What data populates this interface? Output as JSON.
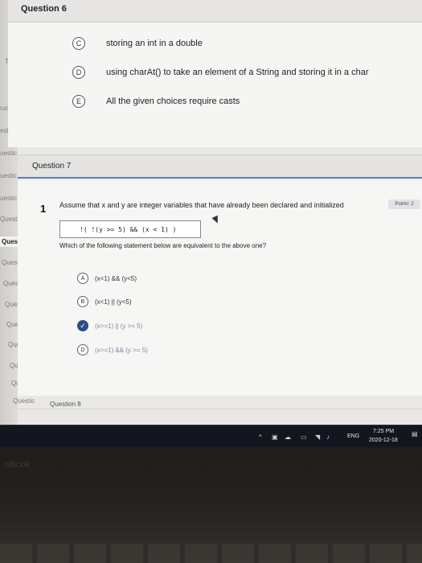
{
  "left_rail": {
    "items": [
      "T",
      "ruc",
      "estic",
      "uestic",
      "uestic",
      "uestic",
      "Questic",
      "Questic",
      "Questic",
      "Questic",
      "Questic",
      "Questic",
      "Questic",
      "Questic",
      "Questic",
      "Questic",
      "Questic"
    ],
    "active_label": "Questic"
  },
  "question6": {
    "title": "Question 6",
    "options": [
      {
        "letter": "C",
        "text": "storing an int in a double"
      },
      {
        "letter": "D",
        "text": "using charAt() to take an element of a String and storing it in a char"
      },
      {
        "letter": "E",
        "text": "All the given choices require casts"
      }
    ]
  },
  "question7": {
    "title": "Question 7",
    "number": "1",
    "prompt": "Assume that x and y are integer variables that have already been declared and initialized",
    "points": "Points: 2",
    "code": "!( !(y >= 5) && (x < 1) )",
    "which": "Which of the following statement below are equivalent to the above one?",
    "answers": [
      {
        "letter": "A",
        "text": "(x<1) && (y<5)",
        "checked": false
      },
      {
        "letter": "B",
        "text": "(x<1) || (y<5)",
        "checked": false
      },
      {
        "letter": "C",
        "text": "(x>=1) || (y >= 5)",
        "checked": true
      },
      {
        "letter": "D",
        "text": "(x>=1) && (y >= 5)",
        "checked": false
      }
    ]
  },
  "question8": {
    "title": "Question 8"
  },
  "taskbar": {
    "language": "ENG",
    "time": "7:25 PM",
    "date": "2020-12-18"
  },
  "device": {
    "brand": "oBook"
  },
  "colors": {
    "accent": "#4b86c6",
    "checked": "#2d4c8a"
  }
}
